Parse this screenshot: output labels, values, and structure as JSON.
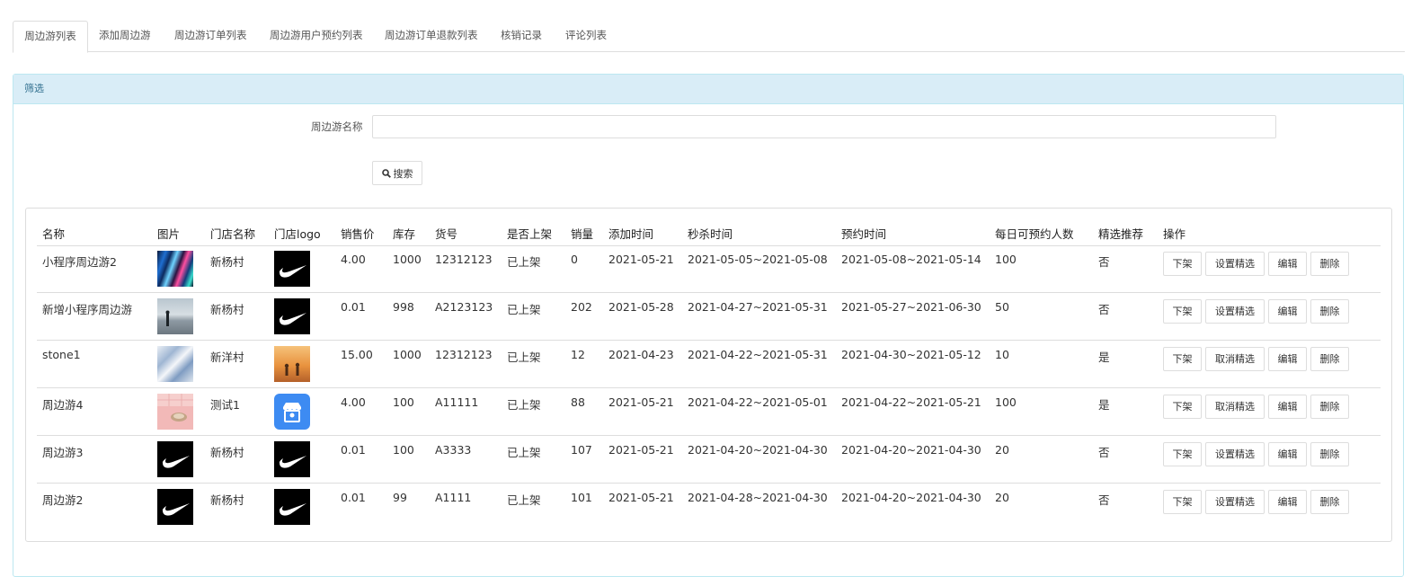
{
  "tabs": [
    "周边游列表",
    "添加周边游",
    "周边游订单列表",
    "周边游用户预约列表",
    "周边游订单退款列表",
    "核销记录",
    "评论列表"
  ],
  "filter": {
    "panel_title": "筛选",
    "name_label": "周边游名称",
    "name_value": "",
    "search_label": "搜索"
  },
  "table": {
    "headers": [
      "名称",
      "图片",
      "门店名称",
      "门店logo",
      "销售价",
      "库存",
      "货号",
      "是否上架",
      "销量",
      "添加时间",
      "秒杀时间",
      "预约时间",
      "每日可预约人数",
      "精选推荐",
      "操作"
    ],
    "rows": [
      {
        "name": "小程序周边游2",
        "image": "abstract-colorful",
        "store": "新杨村",
        "logo": "nike-swoosh",
        "price": "4.00",
        "stock": "1000",
        "sku": "12312123",
        "status": "已上架",
        "sales": "0",
        "added": "2021-05-21",
        "seckill": "2021-05-05~2021-05-08",
        "reserve": "2021-05-08~2021-05-14",
        "daily": "100",
        "featured": "否",
        "actions": [
          "下架",
          "设置精选",
          "编辑",
          "删除"
        ]
      },
      {
        "name": "新增小程序周边游",
        "image": "seaside-person",
        "store": "新杨村",
        "logo": "nike-swoosh",
        "price": "0.01",
        "stock": "998",
        "sku": "A2123123",
        "status": "已上架",
        "sales": "202",
        "added": "2021-05-28",
        "seckill": "2021-04-27~2021-05-31",
        "reserve": "2021-05-27~2021-06-30",
        "daily": "50",
        "featured": "否",
        "actions": [
          "下架",
          "设置精选",
          "编辑",
          "删除"
        ]
      },
      {
        "name": "stone1",
        "image": "blue-white-abstract",
        "store": "新洋村",
        "logo": "desert-travelers",
        "price": "15.00",
        "stock": "1000",
        "sku": "12312123",
        "status": "已上架",
        "sales": "12",
        "added": "2021-04-23",
        "seckill": "2021-04-22~2021-05-31",
        "reserve": "2021-04-30~2021-05-12",
        "daily": "10",
        "featured": "是",
        "actions": [
          "下架",
          "取消精选",
          "编辑",
          "删除"
        ]
      },
      {
        "name": "周边游4",
        "image": "pink-shell",
        "store": "测试1",
        "logo": "store-icon",
        "price": "4.00",
        "stock": "100",
        "sku": "A11111",
        "status": "已上架",
        "sales": "88",
        "added": "2021-05-21",
        "seckill": "2021-04-22~2021-05-01",
        "reserve": "2021-04-22~2021-05-21",
        "daily": "100",
        "featured": "是",
        "actions": [
          "下架",
          "取消精选",
          "编辑",
          "删除"
        ]
      },
      {
        "name": "周边游3",
        "image": "nike-swoosh",
        "store": "新杨村",
        "logo": "nike-swoosh",
        "price": "0.01",
        "stock": "100",
        "sku": "A3333",
        "status": "已上架",
        "sales": "107",
        "added": "2021-05-21",
        "seckill": "2021-04-20~2021-04-30",
        "reserve": "2021-04-20~2021-04-30",
        "daily": "20",
        "featured": "否",
        "actions": [
          "下架",
          "设置精选",
          "编辑",
          "删除"
        ]
      },
      {
        "name": "周边游2",
        "image": "nike-swoosh",
        "store": "新杨村",
        "logo": "nike-swoosh",
        "price": "0.01",
        "stock": "99",
        "sku": "A1111",
        "status": "已上架",
        "sales": "101",
        "added": "2021-05-21",
        "seckill": "2021-04-28~2021-04-30",
        "reserve": "2021-04-20~2021-04-30",
        "daily": "20",
        "featured": "否",
        "actions": [
          "下架",
          "设置精选",
          "编辑",
          "删除"
        ]
      }
    ]
  }
}
